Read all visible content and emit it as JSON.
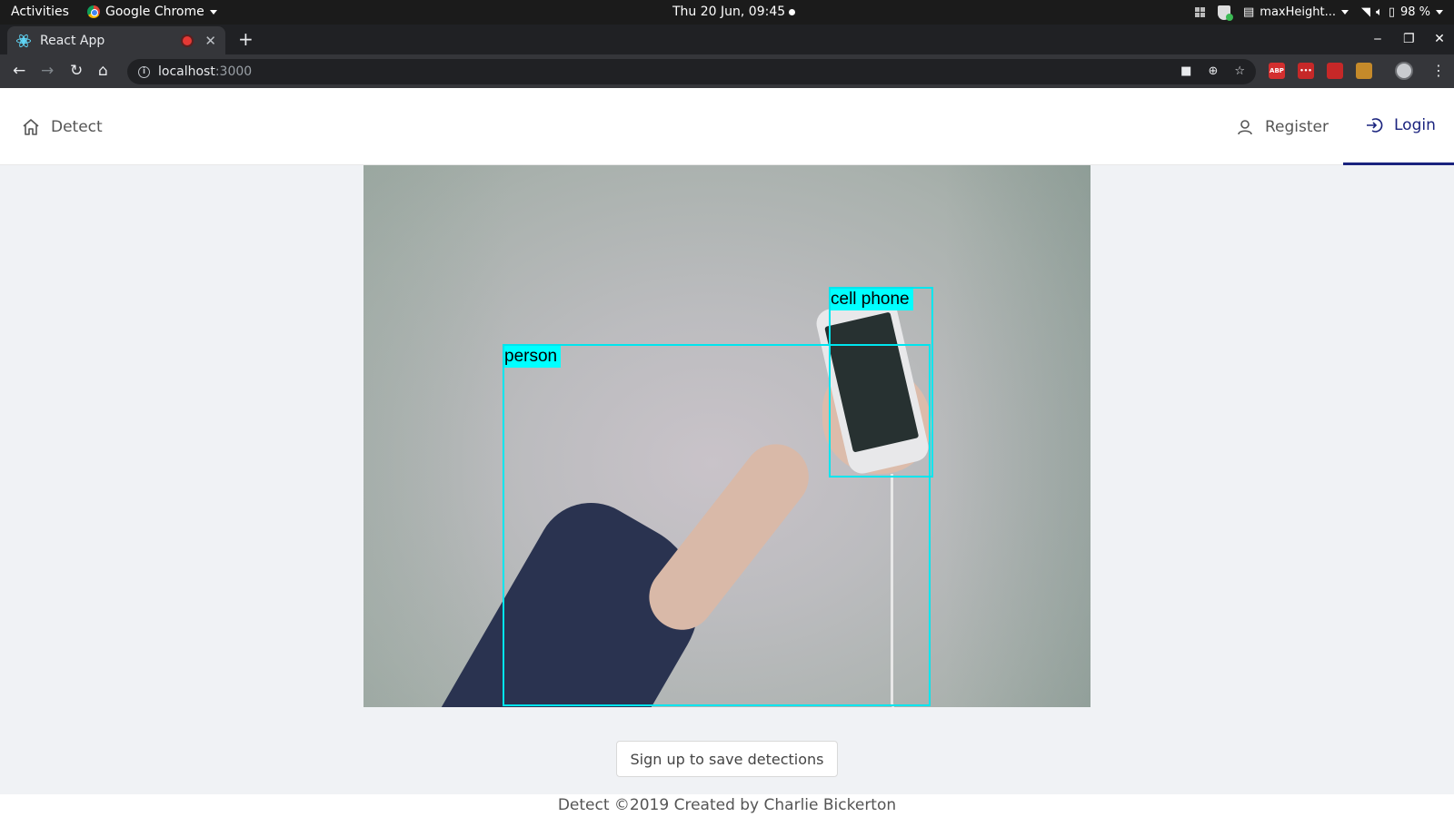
{
  "os_bar": {
    "activities": "Activities",
    "app_name": "Google Chrome",
    "clock": "Thu 20 Jun, 09:45",
    "tray_window": "maxHeight...",
    "battery": "98 %"
  },
  "browser": {
    "tab_title": "React App",
    "url_host": "localhost",
    "url_port": ":3000",
    "extensions": [
      "ABP",
      "•••",
      "",
      ""
    ],
    "extension_colors": [
      "#d32f2f",
      "#c62828",
      "#c62828",
      "#c58a2a"
    ]
  },
  "app": {
    "nav": {
      "detect": "Detect",
      "register": "Register",
      "login": "Login"
    },
    "active_item": "Login",
    "accent_color": "#1a237e",
    "detections": [
      {
        "label": "person"
      },
      {
        "label": "cell phone"
      }
    ],
    "signup_button": "Sign up to save detections",
    "footer": "Detect ©2019 Created by Charlie Bickerton"
  }
}
